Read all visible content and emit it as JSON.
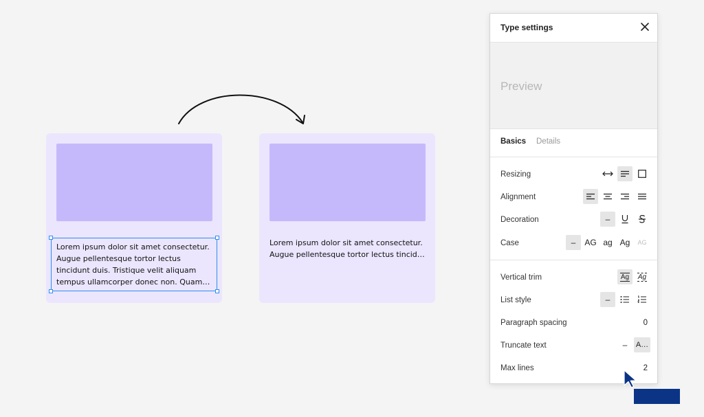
{
  "canvas": {
    "card_left_text": "Lorem ipsum dolor sit amet consectetur. Augue pellentesque tortor lectus tincidunt duis. Tristique velit aliquam tempus ullamcorper donec non. Quam…",
    "card_right_line1": "Lorem ipsum dolor sit amet consectetur.",
    "card_right_line2": "Augue pellentesque tortor lectus tincid…"
  },
  "panel": {
    "title": "Type settings",
    "preview_text": "Preview",
    "tabs": {
      "basics": "Basics",
      "details": "Details"
    },
    "rows": {
      "resizing": "Resizing",
      "alignment": "Alignment",
      "decoration": "Decoration",
      "case": "Case",
      "vertical_trim": "Vertical trim",
      "list_style": "List style",
      "paragraph_spacing": "Paragraph spacing",
      "truncate_text": "Truncate text",
      "max_lines": "Max lines"
    },
    "decoration_none": "–",
    "case_options": {
      "none": "–",
      "upper": "AG",
      "lower": "ag",
      "title": "Ag",
      "small_caps": "AG"
    },
    "list_none": "–",
    "vertical_trim_label": "Ag",
    "paragraph_spacing_value": "0",
    "truncate_off": "–",
    "truncate_on": "A…",
    "max_lines_value": "2"
  },
  "icons": {
    "close": "close-icon",
    "resize_width": "arrows-horizontal-icon",
    "resize_height": "auto-height-icon",
    "resize_fixed": "fixed-size-icon"
  },
  "colors": {
    "selection": "#2c8ef0",
    "card_bg": "#ebe6fd",
    "card_image": "#c6b9fb",
    "cursor": "#0b3487"
  }
}
